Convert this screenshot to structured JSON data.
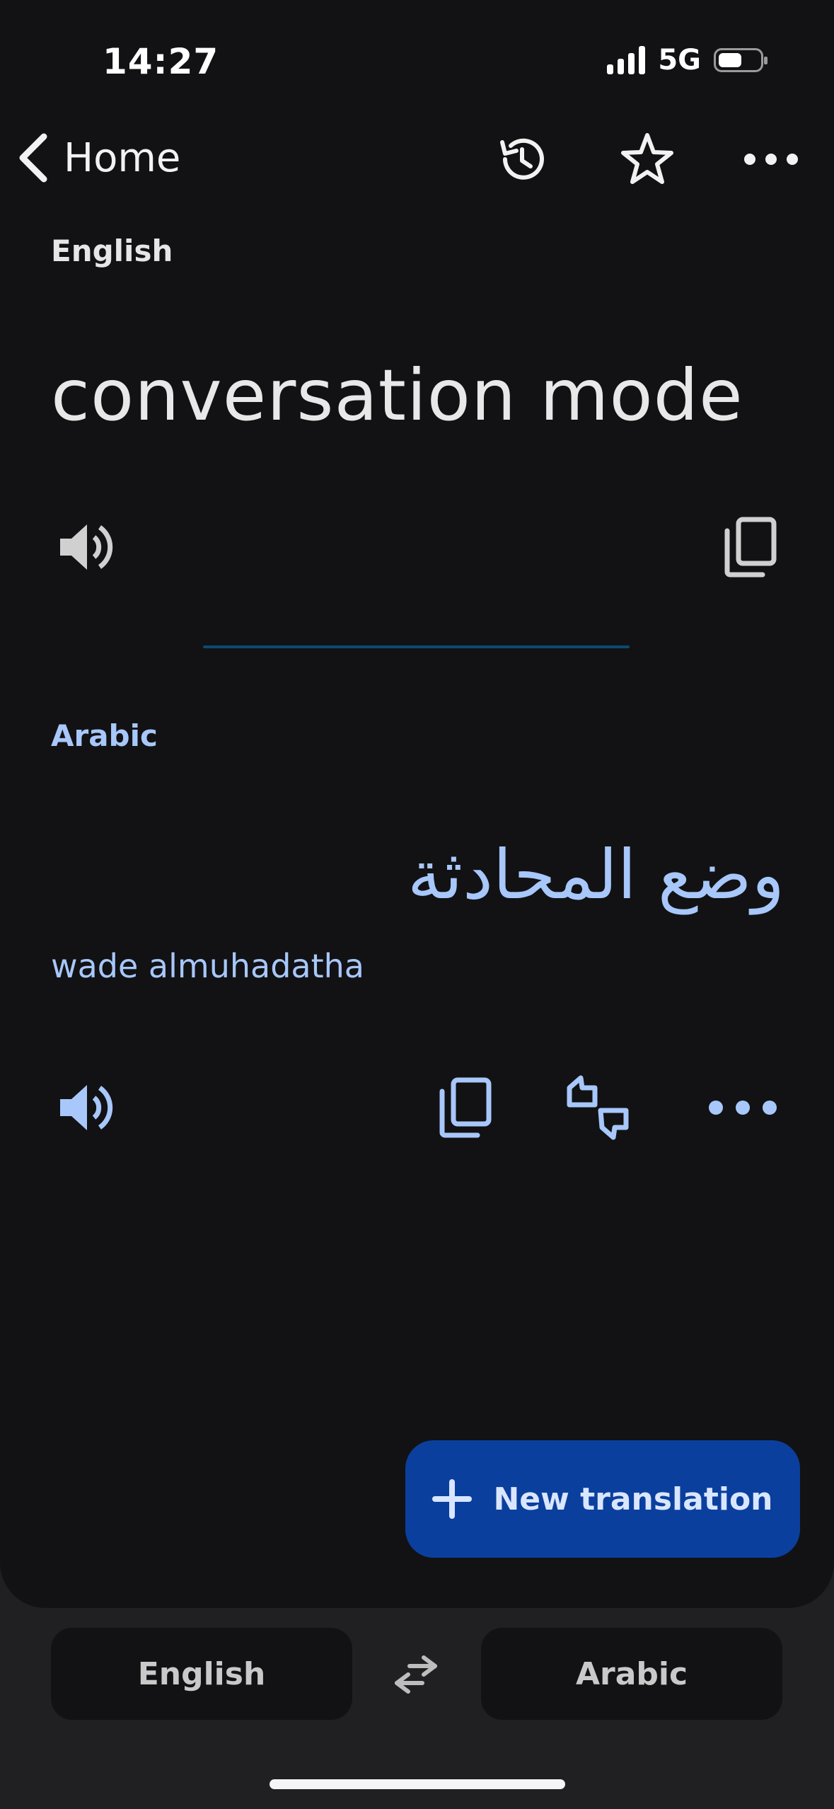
{
  "status": {
    "time": "14:27",
    "network": "5G"
  },
  "header": {
    "back_label": "Home",
    "icons": [
      "history-icon",
      "star-icon",
      "more-icon"
    ]
  },
  "source": {
    "language": "English",
    "text": "conversation mode",
    "icons": [
      "speaker-icon",
      "copy-icon"
    ]
  },
  "target": {
    "language": "Arabic",
    "text": "وضع المحادثة",
    "transliteration": "wade almuhadatha",
    "icons": [
      "speaker-icon",
      "copy-icon",
      "feedback-icon",
      "more-icon"
    ]
  },
  "fab": {
    "label": "New translation"
  },
  "language_bar": {
    "source": "English",
    "target": "Arabic"
  },
  "colors": {
    "accent": "#a8c7fa",
    "fab": "#0b3f9e",
    "background": "#121214"
  }
}
